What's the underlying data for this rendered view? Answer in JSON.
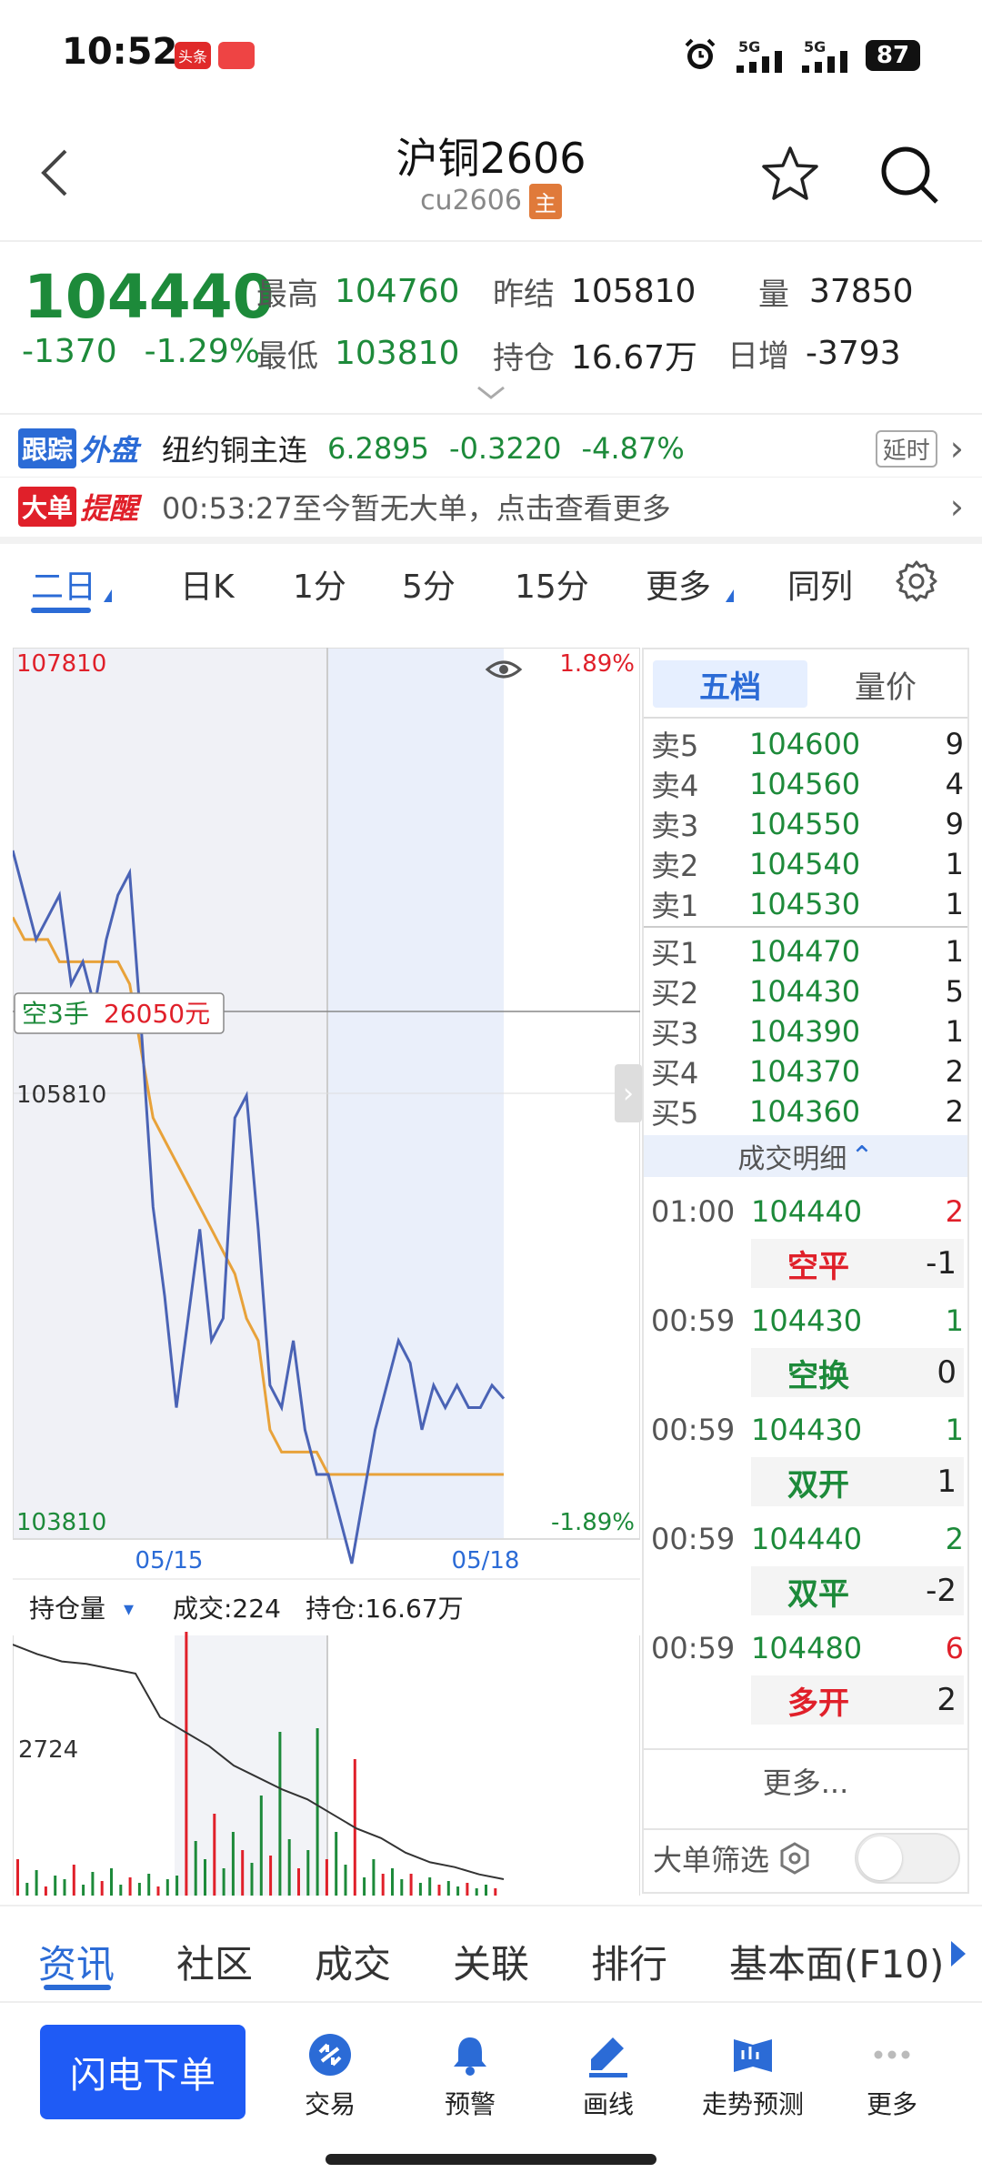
{
  "status_bar": {
    "time": "10:52",
    "chip1": "头条",
    "chip2": "",
    "sig1": "5G",
    "sig2": "5G",
    "battery": "87"
  },
  "header": {
    "title": "沪铜2606",
    "subtitle": "cu2606",
    "badge": "主"
  },
  "quote": {
    "price": "104440",
    "change": "-1370",
    "change_pct": "-1.29%",
    "high_label": "最高",
    "high": "104760",
    "low_label": "最低",
    "low": "103810",
    "prev_label": "昨结",
    "prev": "105810",
    "oi_label": "持仓",
    "oi": "16.67万",
    "vol_label": "量",
    "vol": "37850",
    "daily_label": "日增",
    "daily": "-3793"
  },
  "foreign": {
    "tag1": "跟踪",
    "tag2": "外盘",
    "name": "纽约铜主连",
    "price": "6.2895",
    "change": "-0.3220",
    "pct": "-4.87%",
    "delay": "延时"
  },
  "alert": {
    "tag1": "大单",
    "tag2": "提醒",
    "text": "00:53:27至今暂无大单，点击查看更多"
  },
  "period_tabs": [
    "二日",
    "日K",
    "1分",
    "5分",
    "15分",
    "更多",
    "同列"
  ],
  "chart": {
    "y_top": "107810",
    "y_mid": "105810",
    "y_bot": "103810",
    "pct_top": "1.89%",
    "pct_bot": "-1.89%",
    "x_left": "05/15",
    "x_right": "05/18",
    "cross_label": "空3手",
    "cross_value": "26050元",
    "sub_selector": "持仓量",
    "sub_volume": "成交:224",
    "sub_oi": "持仓:16.67万",
    "sub_ylabel": "2724"
  },
  "chart_data": {
    "type": "line",
    "title": "",
    "xlabel": "",
    "ylabel": "",
    "x": [
      "05/15",
      "05/18"
    ],
    "ylim": [
      103810,
      107810
    ],
    "reference": 105810,
    "series": [
      {
        "values": [
          106900,
          106700,
          106500,
          106600,
          106700,
          106300,
          106400,
          106200,
          106500,
          106700,
          106800,
          106100,
          105300,
          104900,
          104400,
          104800,
          105200,
          104700,
          104800,
          105700,
          105800,
          105200,
          104500,
          104400,
          104700,
          104300,
          104100,
          104100,
          103900,
          103700,
          104000,
          104300,
          104500,
          104700,
          104600,
          104300,
          104500,
          104400,
          104500,
          104400,
          104400,
          104500,
          104440
        ]
      },
      {
        "values": [
          106600,
          106500,
          106500,
          106500,
          106400,
          106400,
          106400,
          106400,
          106400,
          106400,
          106300,
          106000,
          105700,
          105600,
          105500,
          105400,
          105300,
          105200,
          105100,
          105000,
          104800,
          104700,
          104300,
          104200,
          104200,
          104200,
          104200,
          104100,
          104100,
          104100,
          104100,
          104100,
          104100,
          104100,
          104100,
          104100,
          104100,
          104100,
          104100,
          104100,
          104100,
          104100,
          104100
        ]
      }
    ]
  },
  "order_book": {
    "tabs": [
      "五档",
      "量价"
    ],
    "asks": [
      {
        "label": "卖5",
        "price": "104600",
        "vol": "9"
      },
      {
        "label": "卖4",
        "price": "104560",
        "vol": "4"
      },
      {
        "label": "卖3",
        "price": "104550",
        "vol": "9"
      },
      {
        "label": "卖2",
        "price": "104540",
        "vol": "1"
      },
      {
        "label": "卖1",
        "price": "104530",
        "vol": "1"
      }
    ],
    "bids": [
      {
        "label": "买1",
        "price": "104470",
        "vol": "1"
      },
      {
        "label": "买2",
        "price": "104430",
        "vol": "5"
      },
      {
        "label": "买3",
        "price": "104390",
        "vol": "1"
      },
      {
        "label": "买4",
        "price": "104370",
        "vol": "2"
      },
      {
        "label": "买5",
        "price": "104360",
        "vol": "2"
      }
    ],
    "trades_header": "成交明细",
    "trades": [
      {
        "time": "01:00",
        "price": "104440",
        "vol": "2",
        "action": "空平",
        "net": "-1",
        "color": "#e0202a"
      },
      {
        "time": "00:59",
        "price": "104430",
        "vol": "1",
        "action": "空换",
        "net": "0",
        "color": "#1d8a3a"
      },
      {
        "time": "00:59",
        "price": "104430",
        "vol": "1",
        "action": "双开",
        "net": "1",
        "color": "#1d8a3a"
      },
      {
        "time": "00:59",
        "price": "104440",
        "vol": "2",
        "action": "双平",
        "net": "-2",
        "color": "#1d8a3a"
      },
      {
        "time": "00:59",
        "price": "104480",
        "vol": "6",
        "action": "多开",
        "net": "2",
        "color": "#e0202a"
      }
    ],
    "more": "更多...",
    "filter": "大单筛选"
  },
  "bottom_tabs": [
    "资讯",
    "社区",
    "成交",
    "关联",
    "排行",
    "基本面(F10)"
  ],
  "nav": {
    "order_button": "闪电下单",
    "items": [
      "交易",
      "预警",
      "画线",
      "走势预测",
      "更多"
    ]
  },
  "colors": {
    "accent": "#2b6bd6",
    "up": "#e0202a",
    "down": "#1d8a3a",
    "line": "#4a63b5",
    "avg": "#e8a23a"
  }
}
